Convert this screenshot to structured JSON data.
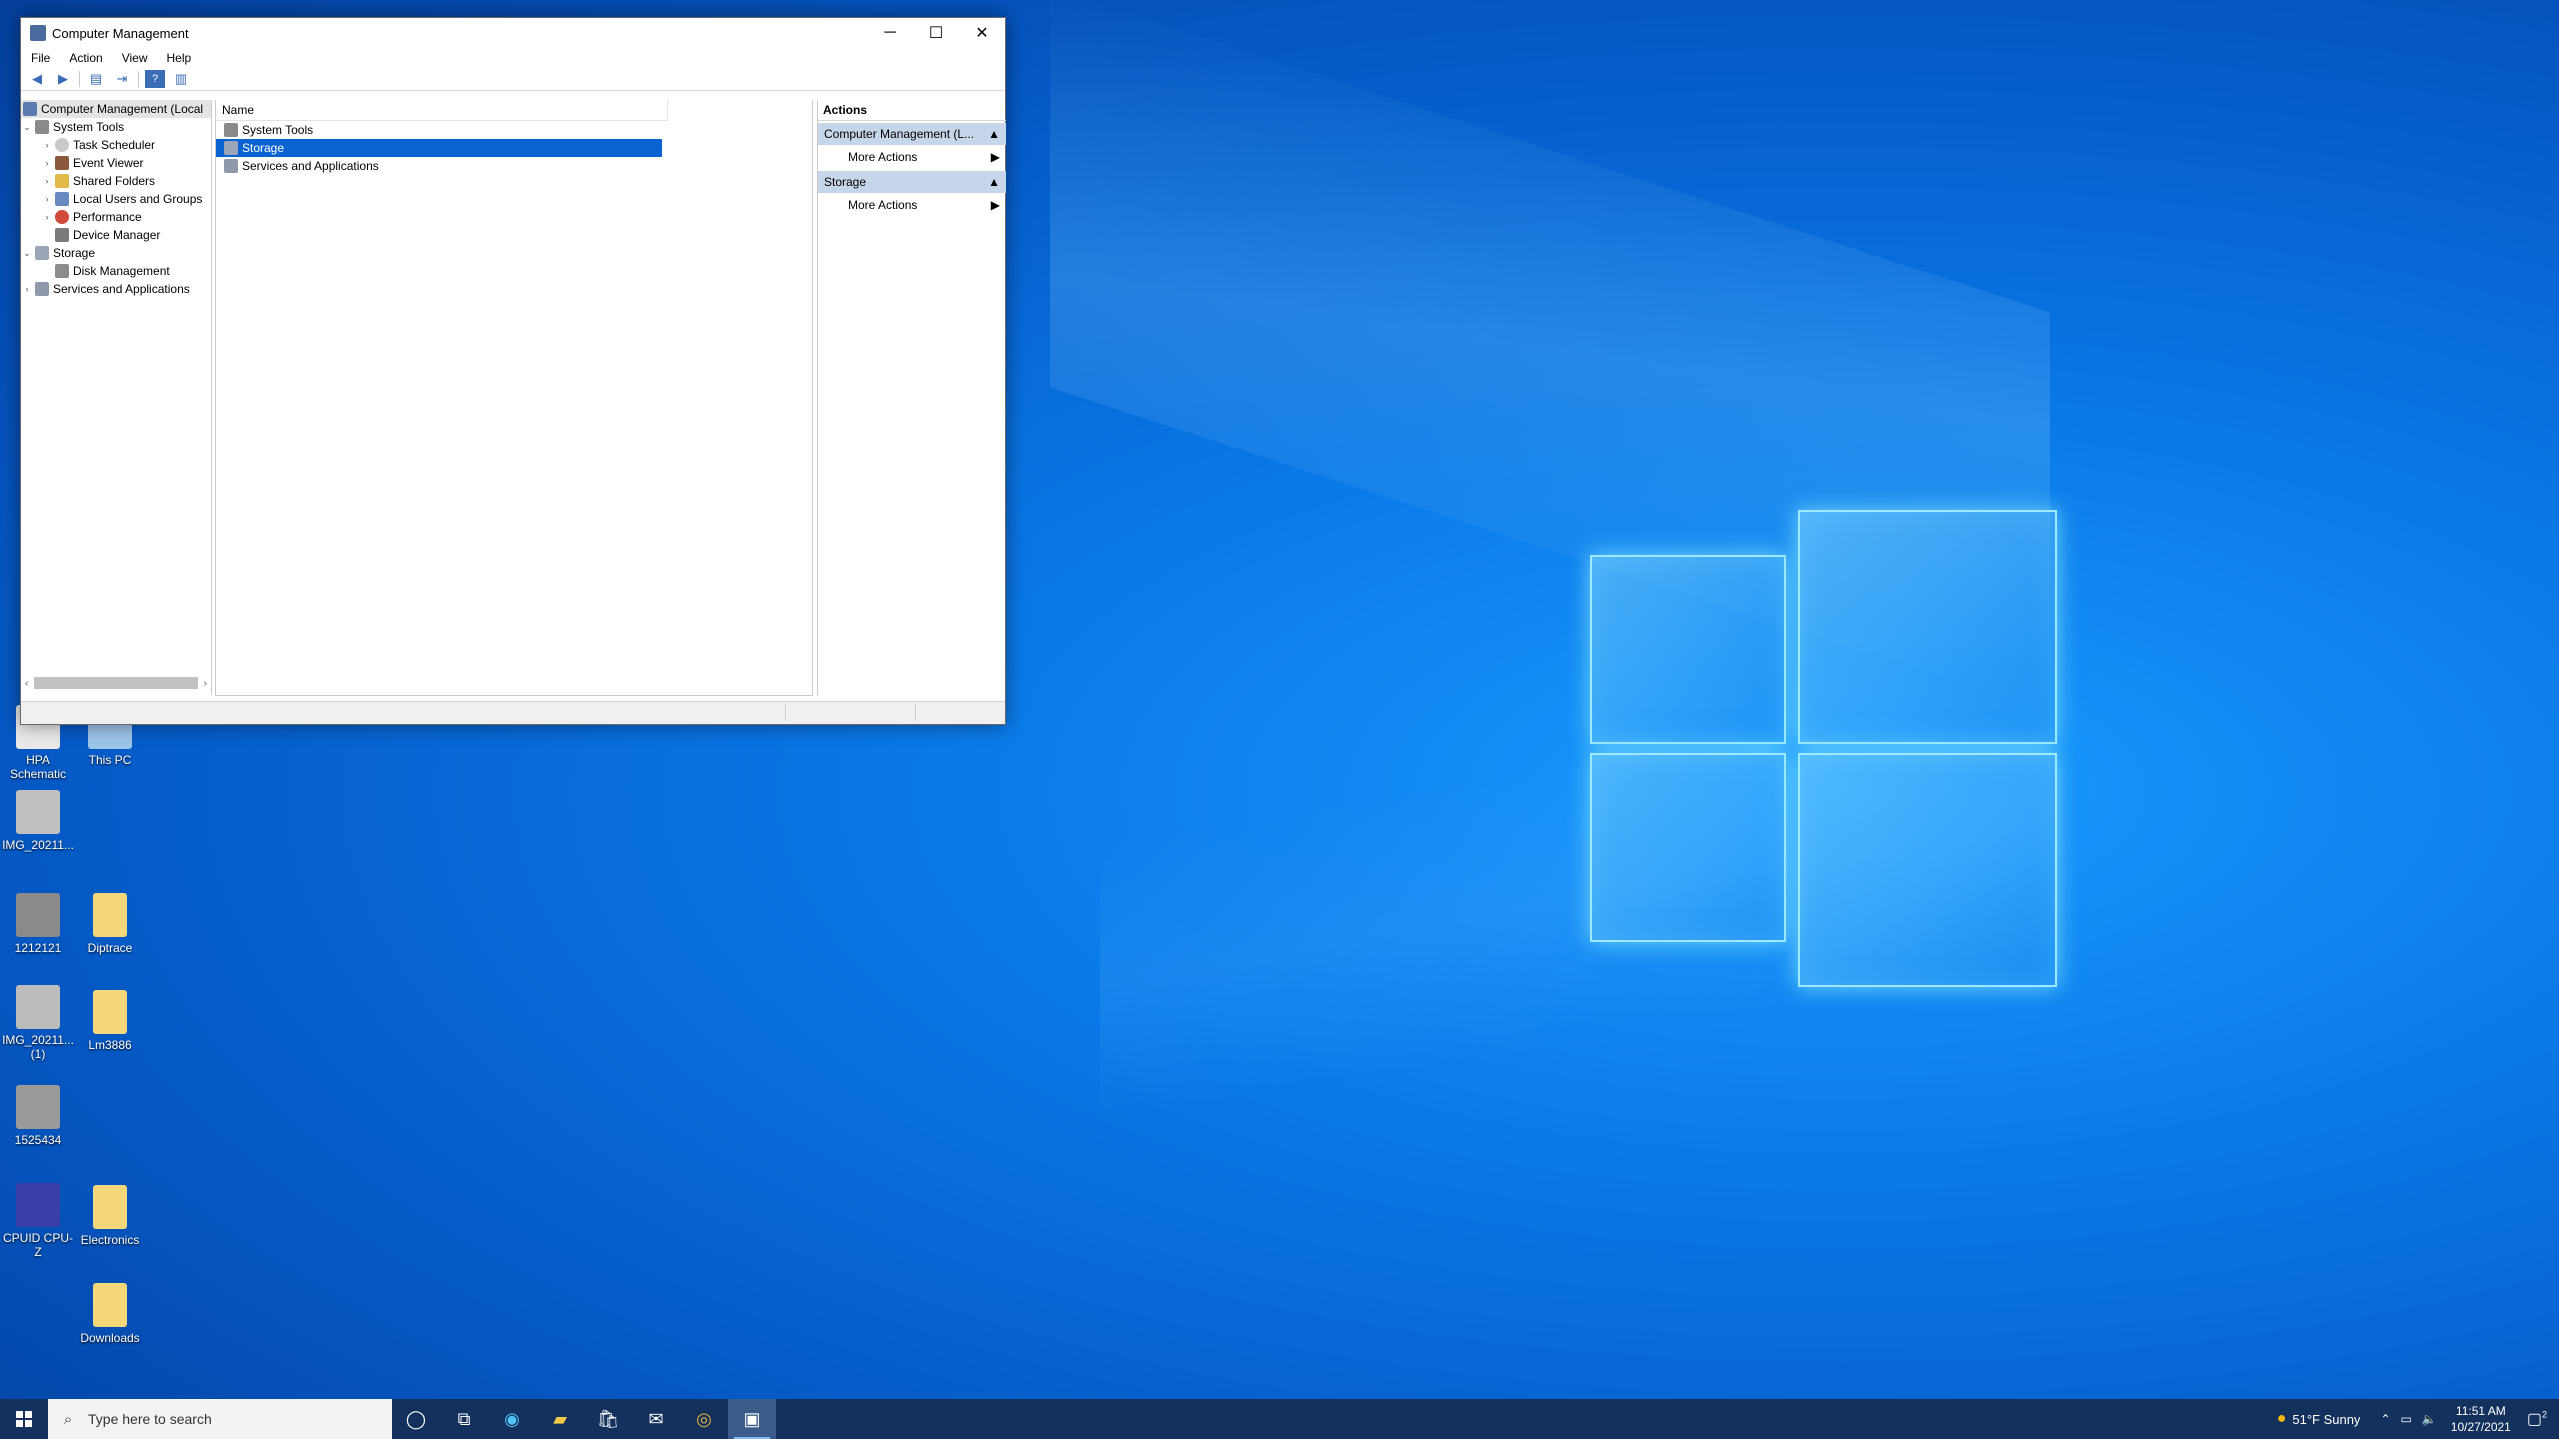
{
  "window": {
    "title": "Computer Management",
    "minimize": "─",
    "maximize": "☐",
    "close": "✕"
  },
  "menu": [
    "File",
    "Action",
    "View",
    "Help"
  ],
  "tree": {
    "root": "Computer Management (Local",
    "system_tools": "System Tools",
    "task_scheduler": "Task Scheduler",
    "event_viewer": "Event Viewer",
    "shared_folders": "Shared Folders",
    "local_users": "Local Users and Groups",
    "performance": "Performance",
    "device_manager": "Device Manager",
    "storage": "Storage",
    "disk_management": "Disk Management",
    "services": "Services and Applications"
  },
  "list": {
    "column": "Name",
    "items": [
      "System Tools",
      "Storage",
      "Services and Applications"
    ],
    "selected_index": 1
  },
  "actions": {
    "header": "Actions",
    "group1": "Computer Management (L...",
    "group1_item": "More Actions",
    "group2": "Storage",
    "group2_item": "More Actions"
  },
  "desktop_icons": [
    {
      "label": "HPA Schematic",
      "color": "#e9e9e9"
    },
    {
      "label": "This PC",
      "color": "#9cc5ea"
    },
    {
      "label": "IMG_20211...",
      "color": "#bfbfbf"
    },
    {
      "label": "1212121",
      "color": "#8a8a8a"
    },
    {
      "label": "Diptrace",
      "color": "#f3d77a"
    },
    {
      "label": "IMG_20211... (1)",
      "color": "#bcbcbc"
    },
    {
      "label": "Lm3886",
      "color": "#f3d77a"
    },
    {
      "label": "1525434",
      "color": "#9a9a9a"
    },
    {
      "label": "CPUID CPU-Z",
      "color": "#3a3fa8"
    },
    {
      "label": "Electronics",
      "color": "#f3d77a"
    },
    {
      "label": "Downloads",
      "color": "#f3d77a"
    }
  ],
  "taskbar": {
    "search_placeholder": "Type here to search",
    "weather": "51°F  Sunny",
    "time": "11:51 AM",
    "date": "10/27/2021",
    "notification_count": "2"
  },
  "colors": {
    "selection": "#0a63d0",
    "taskbar": "#13315c",
    "desktop": "#0a78e6"
  }
}
